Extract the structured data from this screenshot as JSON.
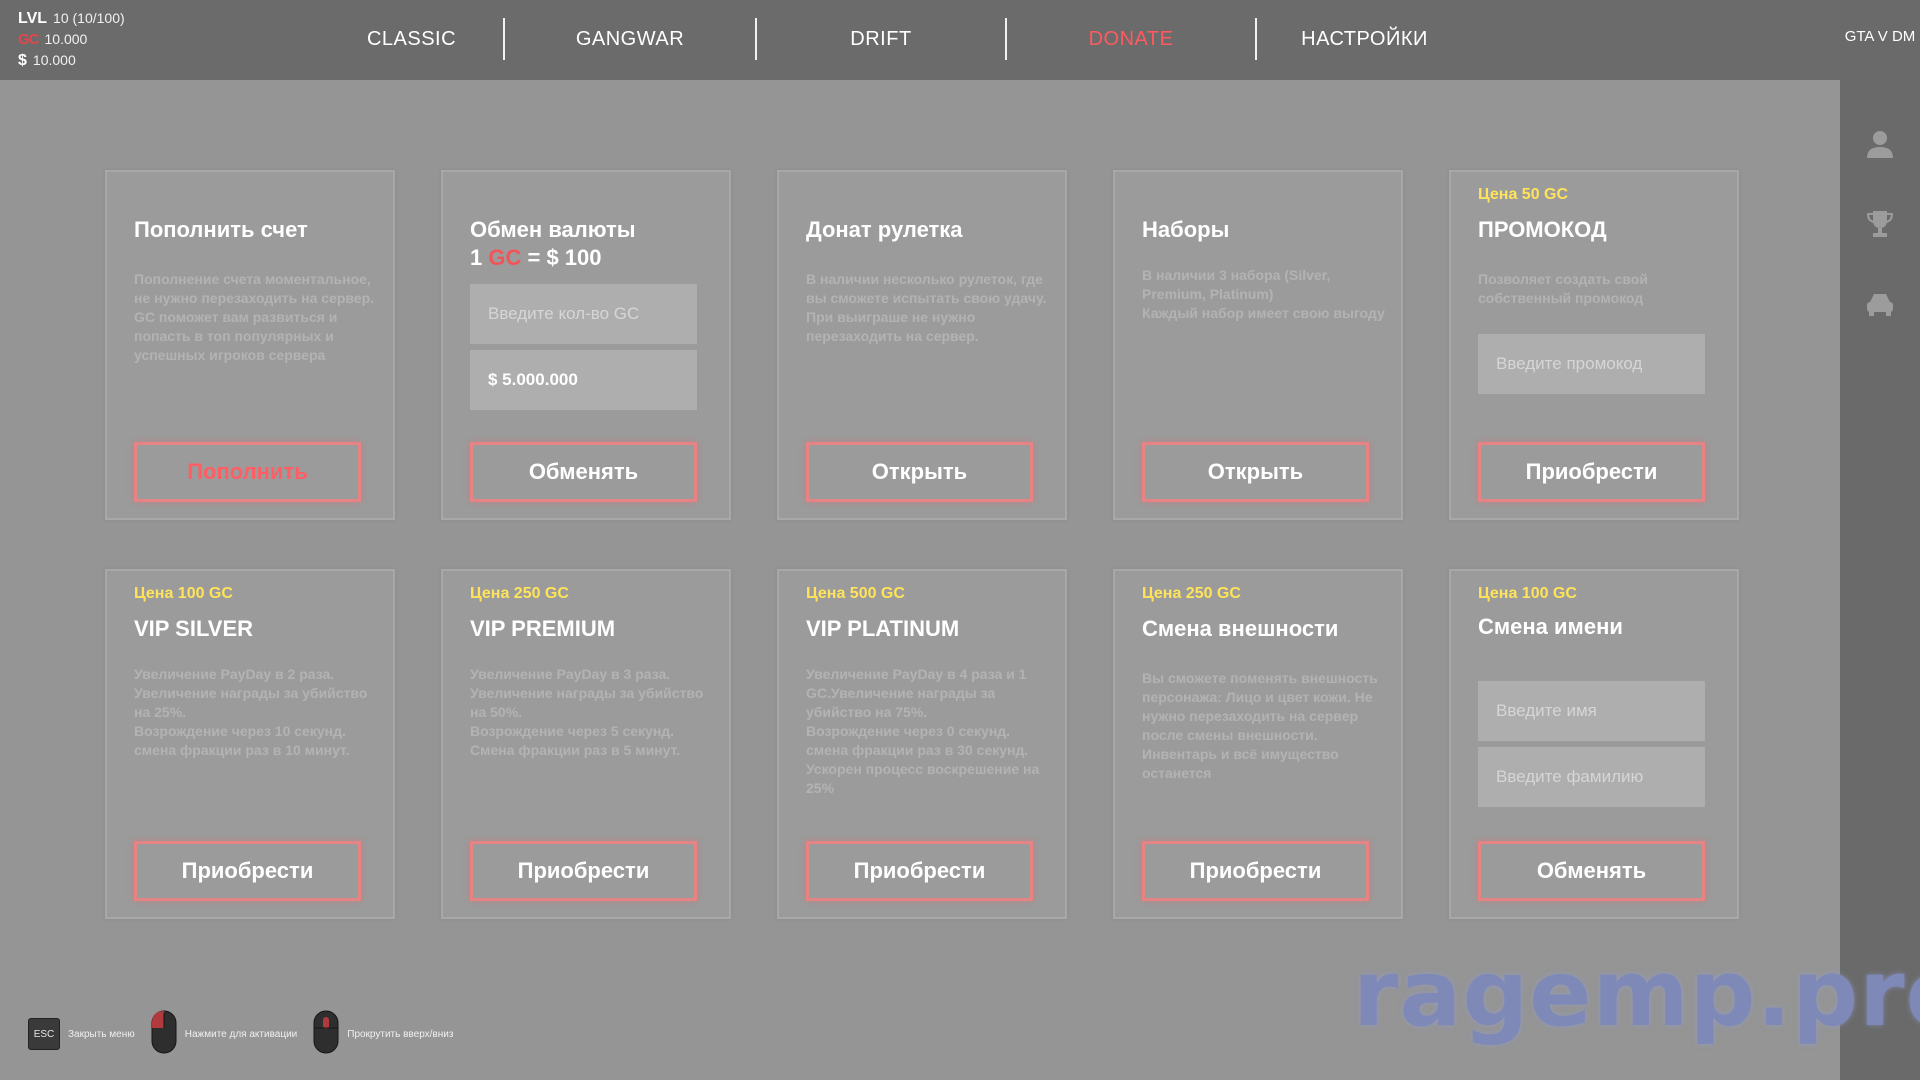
{
  "header": {
    "level_key": "LVL",
    "level_value": "10 (10/100)",
    "gc_symbol": "GC",
    "gc_value": "10.000",
    "dollar_symbol": "$",
    "money_value": "10.000"
  },
  "nav": {
    "tabs": [
      {
        "label": "CLASSIC",
        "active": false
      },
      {
        "label": "GANGWAR",
        "active": false
      },
      {
        "label": "DRIFT",
        "active": false
      },
      {
        "label": "DONATE",
        "active": true
      },
      {
        "label": "НАСТРОЙКИ",
        "active": false
      }
    ]
  },
  "sidebar": {
    "brand": "GTA V DM",
    "icons": [
      "user-icon",
      "trophy-icon",
      "car-icon"
    ]
  },
  "cards": [
    {
      "price": "",
      "title": "Пополнить счет",
      "desc": "Пополнение счета моментальное, не нужно перезаходить на сервер.\nGC поможет вам развиться и попасть в топ популярных и успешных игроков сервера",
      "button": "Пополнить"
    },
    {
      "title_line1": "Обмен валюты",
      "title_prefix": "1",
      "title_gc": "GC",
      "title_suffix": "= $ 100",
      "gc_placeholder": "Введите кол-во GC",
      "money_result": "$ 5.000.000",
      "button": "Обменять"
    },
    {
      "price": "",
      "title": "Донат рулетка",
      "desc": "В наличии несколько рулеток, где вы сможете испытать свою удачу.\nПри выиграше не нужно перезаходить на сервер.",
      "button": "Открыть"
    },
    {
      "price": "",
      "title": "Наборы",
      "desc": "В наличии 3 набора (Silver, Premium, Platinum)\nКаждый набор имеет свою выгоду",
      "button": "Открыть"
    },
    {
      "price": "Цена 50 GC",
      "title": "ПРОМОКОД",
      "desc": "Позволяет создать свой собственный промокод",
      "placeholder": "Введите промокод",
      "button": "Приобрести"
    },
    {
      "price": "Цена 100 GC",
      "title": "VIP SILVER",
      "desc": "Увеличение PayDay в 2 раза. Увеличение награды за убийство на 25%.\nВозрождение через 10 секунд.\nсмена фракции раз в 10 минут.",
      "button": "Приобрести"
    },
    {
      "price": "Цена 250 GC",
      "title": "VIP PREMIUM",
      "desc": "Увеличение PayDay в 3 раза. Увеличение награды за убийство на 50%.\nВозрождение через 5 секунд.\nСмена фракции раз в 5 минут.",
      "button": "Приобрести"
    },
    {
      "price": "Цена 500 GC",
      "title": "VIP PLATINUM",
      "desc": "Увеличение PayDay в 4 раза и 1 GC.Увеличение награды за убийство на 75%.\nВозрождение через 0 секунд.\nсмена фракции раз в 30 секунд.\nУскорен процесс воскрешение на 25%",
      "button": "Приобрести"
    },
    {
      "price": "Цена 250 GC",
      "title": "Смена внешности",
      "desc": "Вы сможете поменять внешность персонажа: Лицо и цвет кожи. Не нужно перезаходить на сервер после смены внешности. Инвентарь и всё имущество останется",
      "button": "Приобрести"
    },
    {
      "price": "Цена 100 GC",
      "title": "Смена имени",
      "first_name_placeholder": "Введите имя",
      "last_name_placeholder": "Введите фамилию",
      "button": "Обменять"
    }
  ],
  "footer": {
    "esc_key": "ESC",
    "hints": [
      "Закрыть меню",
      "Нажмите для активации",
      "Прокрутить вверх/вниз"
    ]
  },
  "watermark": "ragemp.pro",
  "colors": {
    "accent_red": "#ff5a5f",
    "price_yellow": "#ffe35a",
    "background": "#959595",
    "topbar": "#6b6b6b"
  }
}
